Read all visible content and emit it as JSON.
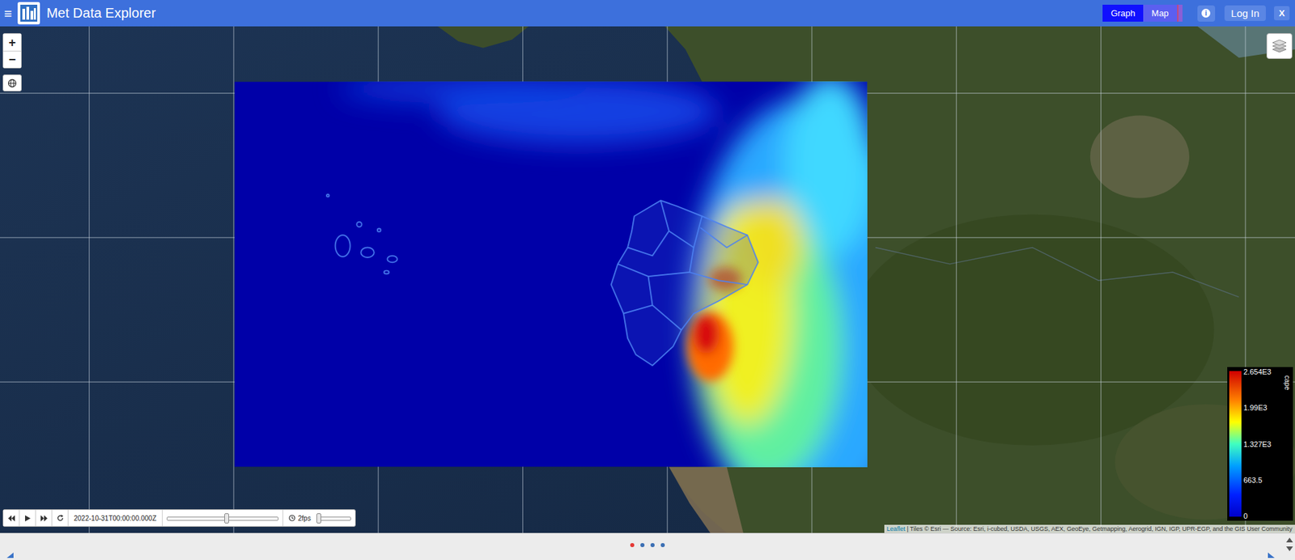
{
  "header": {
    "menu_icon": "≡",
    "title": "Met Data Explorer",
    "view_buttons": [
      {
        "label": "Graph",
        "selected": true
      },
      {
        "label": "Map",
        "selected": false
      }
    ],
    "info_icon": "i",
    "login": "Log In",
    "close": "X"
  },
  "map": {
    "zoom_in": "+",
    "zoom_out": "−"
  },
  "legend": {
    "title": "cape",
    "ticks": [
      "2.654E3",
      "1.99E3",
      "1.327E3",
      "663.5",
      "0"
    ]
  },
  "player": {
    "time": "2022-10-31T00:00:00.000Z",
    "time_level": 0.53,
    "fps": "2fps",
    "fps_level": 0.05
  },
  "attribution": {
    "link": "Leaflet",
    "text": " | Tiles © Esri — Source: Esri, i-cubed, USDA, USGS, AEX, GeoEye, Getmapping, Aerogrid, IGN, IGP, UPR-EGP, and the GIS User Community"
  },
  "pager": [
    {
      "selected": true
    },
    {
      "selected": false
    },
    {
      "selected": false
    },
    {
      "selected": false
    }
  ]
}
